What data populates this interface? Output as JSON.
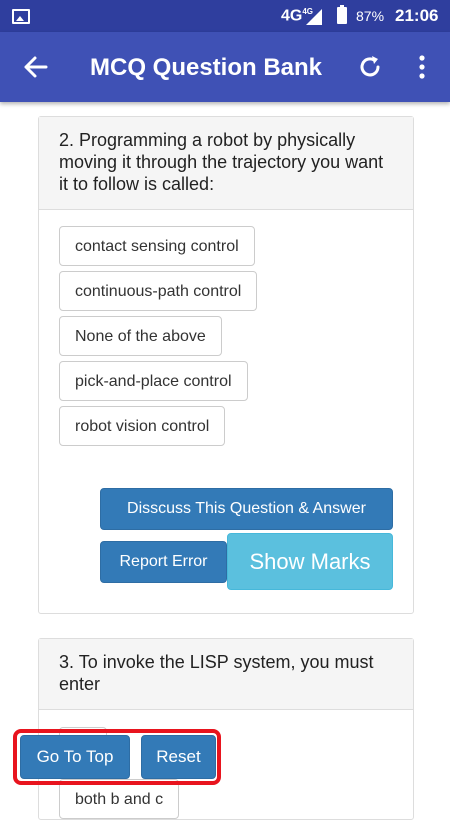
{
  "status_bar": {
    "network": "4G",
    "network_sup": "4G",
    "battery": "87%",
    "time": "21:06"
  },
  "toolbar": {
    "title": "MCQ Question Bank",
    "back_icon": "arrow-back-icon",
    "refresh_icon": "refresh-icon",
    "more_icon": "more-vert-icon"
  },
  "question2": {
    "text": "2. Programming a robot by physically moving it through the trajectory you want it to follow is called:",
    "options": [
      "contact sensing control",
      "continuous-path control",
      "None of the above",
      "pick-and-place control",
      "robot vision control"
    ],
    "discuss_label": "Disscuss This Question & Answer",
    "report_label": "Report Error",
    "marks_label": "Show Marks"
  },
  "question3": {
    "text": "3. To invoke the LISP system, you must enter",
    "options": [
      "",
      "both b and c"
    ]
  },
  "floating": {
    "top_label": "Go To Top",
    "reset_label": "Reset"
  },
  "colors": {
    "statusbar": "#2f3e9e",
    "toolbar": "#3f51b5",
    "primary_button": "#337ab7",
    "info_button": "#5bc0de",
    "highlight_border": "#e8141e"
  }
}
